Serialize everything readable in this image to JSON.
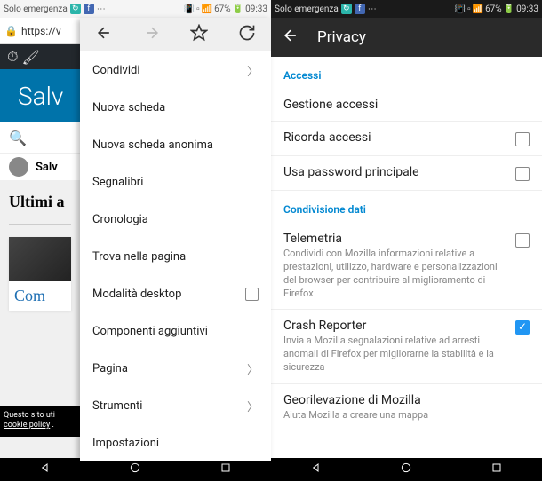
{
  "status": {
    "left": "Solo emergenza",
    "battery": "67%",
    "time": "09:33"
  },
  "left_screen": {
    "url": "https://v",
    "wp_title": "Salv",
    "profile_label": "Salv",
    "heading": "Ultimi a",
    "card_text": "Com",
    "cookie_text": "Questo sito uti",
    "cookie_policy": "cookie policy",
    "menu": [
      {
        "label": "Condividi",
        "chevron": true
      },
      {
        "label": "Nuova scheda"
      },
      {
        "label": "Nuova scheda anonima"
      },
      {
        "label": "Segnalibri"
      },
      {
        "label": "Cronologia"
      },
      {
        "label": "Trova nella pagina"
      },
      {
        "label": "Modalità desktop",
        "checkbox": true
      },
      {
        "label": "Componenti aggiuntivi"
      },
      {
        "label": "Pagina",
        "chevron": true
      },
      {
        "label": "Strumenti",
        "chevron": true
      },
      {
        "label": "Impostazioni"
      }
    ]
  },
  "right_screen": {
    "title": "Privacy",
    "section_access": "Accessi",
    "section_share": "Condivisione dati",
    "rows": {
      "manage": "Gestione accessi",
      "remember": "Ricorda accessi",
      "master_pw": "Usa password principale",
      "telemetry_title": "Telemetria",
      "telemetry_sub": "Condividi con Mozilla informazioni relative a prestazioni, utilizzo, hardware e personalizzazioni del browser per contribuire al miglioramento di Firefox",
      "crash_title": "Crash Reporter",
      "crash_sub": "Invia a Mozilla segnalazioni relative ad arresti anomali di Firefox per migliorarne la stabilità e la sicurezza",
      "geo_title": "Georilevazione di Mozilla",
      "geo_sub": "Aiuta Mozilla a creare una mappa"
    }
  }
}
